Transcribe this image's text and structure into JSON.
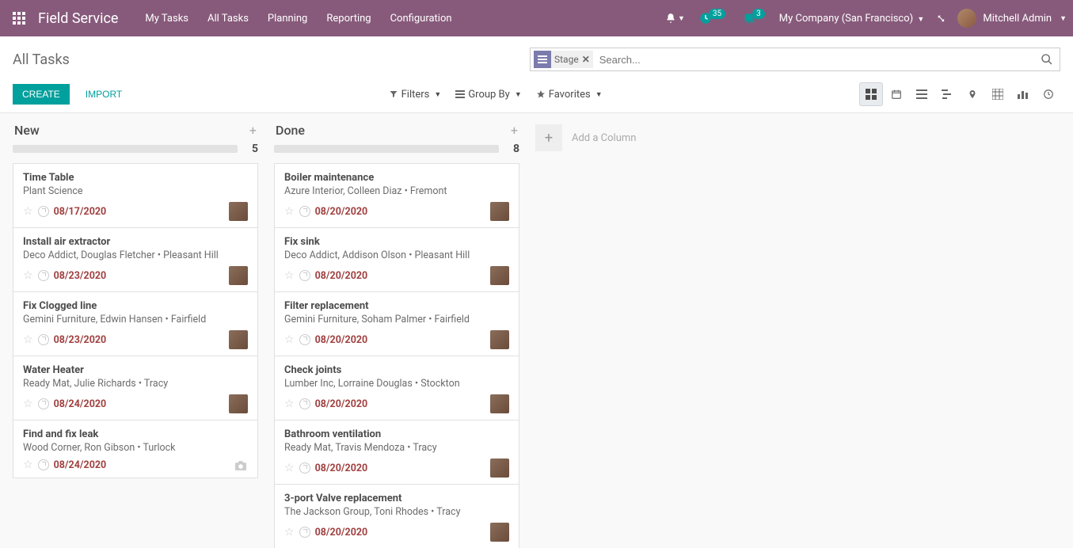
{
  "navbar": {
    "brand": "Field Service",
    "menu": [
      "My Tasks",
      "All Tasks",
      "Planning",
      "Reporting",
      "Configuration"
    ],
    "badge_clock": "35",
    "badge_chat": "3",
    "company": "My Company (San Francisco)",
    "user": "Mitchell Admin"
  },
  "breadcrumb": "All Tasks",
  "search": {
    "facet_label": "Stage",
    "placeholder": "Search..."
  },
  "buttons": {
    "create": "CREATE",
    "import": "IMPORT"
  },
  "toolbar": {
    "filters": "Filters",
    "group_by": "Group By",
    "favorites": "Favorites"
  },
  "add_column": "Add a Column",
  "columns": [
    {
      "title": "New",
      "count": "5",
      "cards": [
        {
          "title": "Time Table",
          "sub": "Plant Science",
          "date": "08/17/2020",
          "avatar": true
        },
        {
          "title": "Install air extractor",
          "sub": "Deco Addict, Douglas Fletcher • Pleasant Hill",
          "date": "08/23/2020",
          "avatar": true
        },
        {
          "title": "Fix Clogged line",
          "sub": "Gemini Furniture, Edwin Hansen • Fairfield",
          "date": "08/23/2020",
          "avatar": true
        },
        {
          "title": "Water Heater",
          "sub": "Ready Mat, Julie Richards • Tracy",
          "date": "08/24/2020",
          "avatar": true
        },
        {
          "title": "Find and fix leak",
          "sub": "Wood Corner, Ron Gibson • Turlock",
          "date": "08/24/2020",
          "camera": true
        }
      ]
    },
    {
      "title": "Done",
      "count": "8",
      "cards": [
        {
          "title": "Boiler maintenance",
          "sub": "Azure Interior, Colleen Diaz • Fremont",
          "date": "08/20/2020",
          "avatar": true
        },
        {
          "title": "Fix sink",
          "sub": "Deco Addict, Addison Olson • Pleasant Hill",
          "date": "08/20/2020",
          "avatar": true
        },
        {
          "title": "Filter replacement",
          "sub": "Gemini Furniture, Soham Palmer • Fairfield",
          "date": "08/20/2020",
          "avatar": true
        },
        {
          "title": "Check joints",
          "sub": "Lumber Inc, Lorraine Douglas • Stockton",
          "date": "08/20/2020",
          "avatar": true
        },
        {
          "title": "Bathroom ventilation",
          "sub": "Ready Mat, Travis Mendoza • Tracy",
          "date": "08/20/2020",
          "avatar": true
        },
        {
          "title": "3-port Valve replacement",
          "sub": "The Jackson Group, Toni Rhodes • Tracy",
          "date": "08/20/2020",
          "avatar": true
        }
      ]
    }
  ]
}
